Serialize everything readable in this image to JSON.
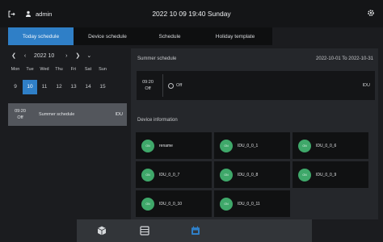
{
  "topbar": {
    "user": "admin",
    "datetime": "2022 10 09 19:40 Sunday"
  },
  "tabs": [
    {
      "label": "Today schedule",
      "active": true
    },
    {
      "label": "Device schedule",
      "active": false
    },
    {
      "label": "Schedule",
      "active": false
    },
    {
      "label": "Holiday template",
      "active": false
    }
  ],
  "calendar": {
    "month": "2022 10",
    "weekdays": [
      "Mon",
      "Tue",
      "Wed",
      "Thu",
      "Fri",
      "Sat",
      "Sun"
    ],
    "days": [
      "9",
      "10",
      "11",
      "12",
      "13",
      "14",
      "15"
    ],
    "selected_day": "10"
  },
  "left_entry": {
    "time": "09:20",
    "state": "Off",
    "name": "Summer schedule",
    "tag": "IDU"
  },
  "schedule": {
    "title": "Summer schedule",
    "date_range": "2022-10-01 To 2022-10-31",
    "row": {
      "time": "09:20",
      "state": "Off",
      "action": "Off",
      "tag": "IDU"
    }
  },
  "devices": {
    "title": "Device information",
    "items": [
      {
        "label": "rename",
        "dot": "ON"
      },
      {
        "label": "IDU_0_0_1",
        "dot": "ON"
      },
      {
        "label": "IDU_0_0_6",
        "dot": "ON"
      },
      {
        "label": "IDU_0_0_7",
        "dot": "ON"
      },
      {
        "label": "IDU_0_0_8",
        "dot": "ON"
      },
      {
        "label": "IDU_0_0_9",
        "dot": "ON"
      },
      {
        "label": "IDU_0_0_10",
        "dot": "ON"
      },
      {
        "label": "IDU_0_0_11",
        "dot": "ON"
      }
    ]
  },
  "colors": {
    "accent": "#2f7fc7",
    "device_on": "#3fa86a",
    "background": "#1b1c1f"
  },
  "icons": {
    "logout": "logout-icon",
    "user": "user-icon",
    "settings": "gear-icon",
    "bottom": [
      "cube-icon",
      "list-icon",
      "calendar-icon"
    ]
  }
}
